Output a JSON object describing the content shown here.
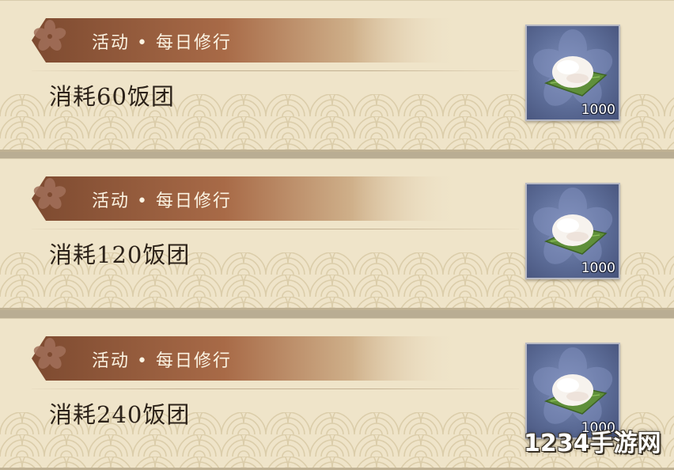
{
  "tasks": [
    {
      "category": "活动 • 每日修行",
      "description": "消耗60饭团",
      "reward": {
        "icon": "rice-ball-icon",
        "count": "1000"
      }
    },
    {
      "category": "活动 • 每日修行",
      "description": "消耗120饭团",
      "reward": {
        "icon": "rice-ball-icon",
        "count": "1000"
      }
    },
    {
      "category": "活动 • 每日修行",
      "description": "消耗240饭团",
      "reward": {
        "icon": "rice-ball-icon",
        "count": "1000"
      }
    }
  ],
  "watermark": "1234手游网",
  "colors": {
    "card_background": "#efe4c9",
    "banner_dark": "#8a5538",
    "banner_light": "#e6d7b6",
    "reward_slot": "#5c6c97"
  }
}
